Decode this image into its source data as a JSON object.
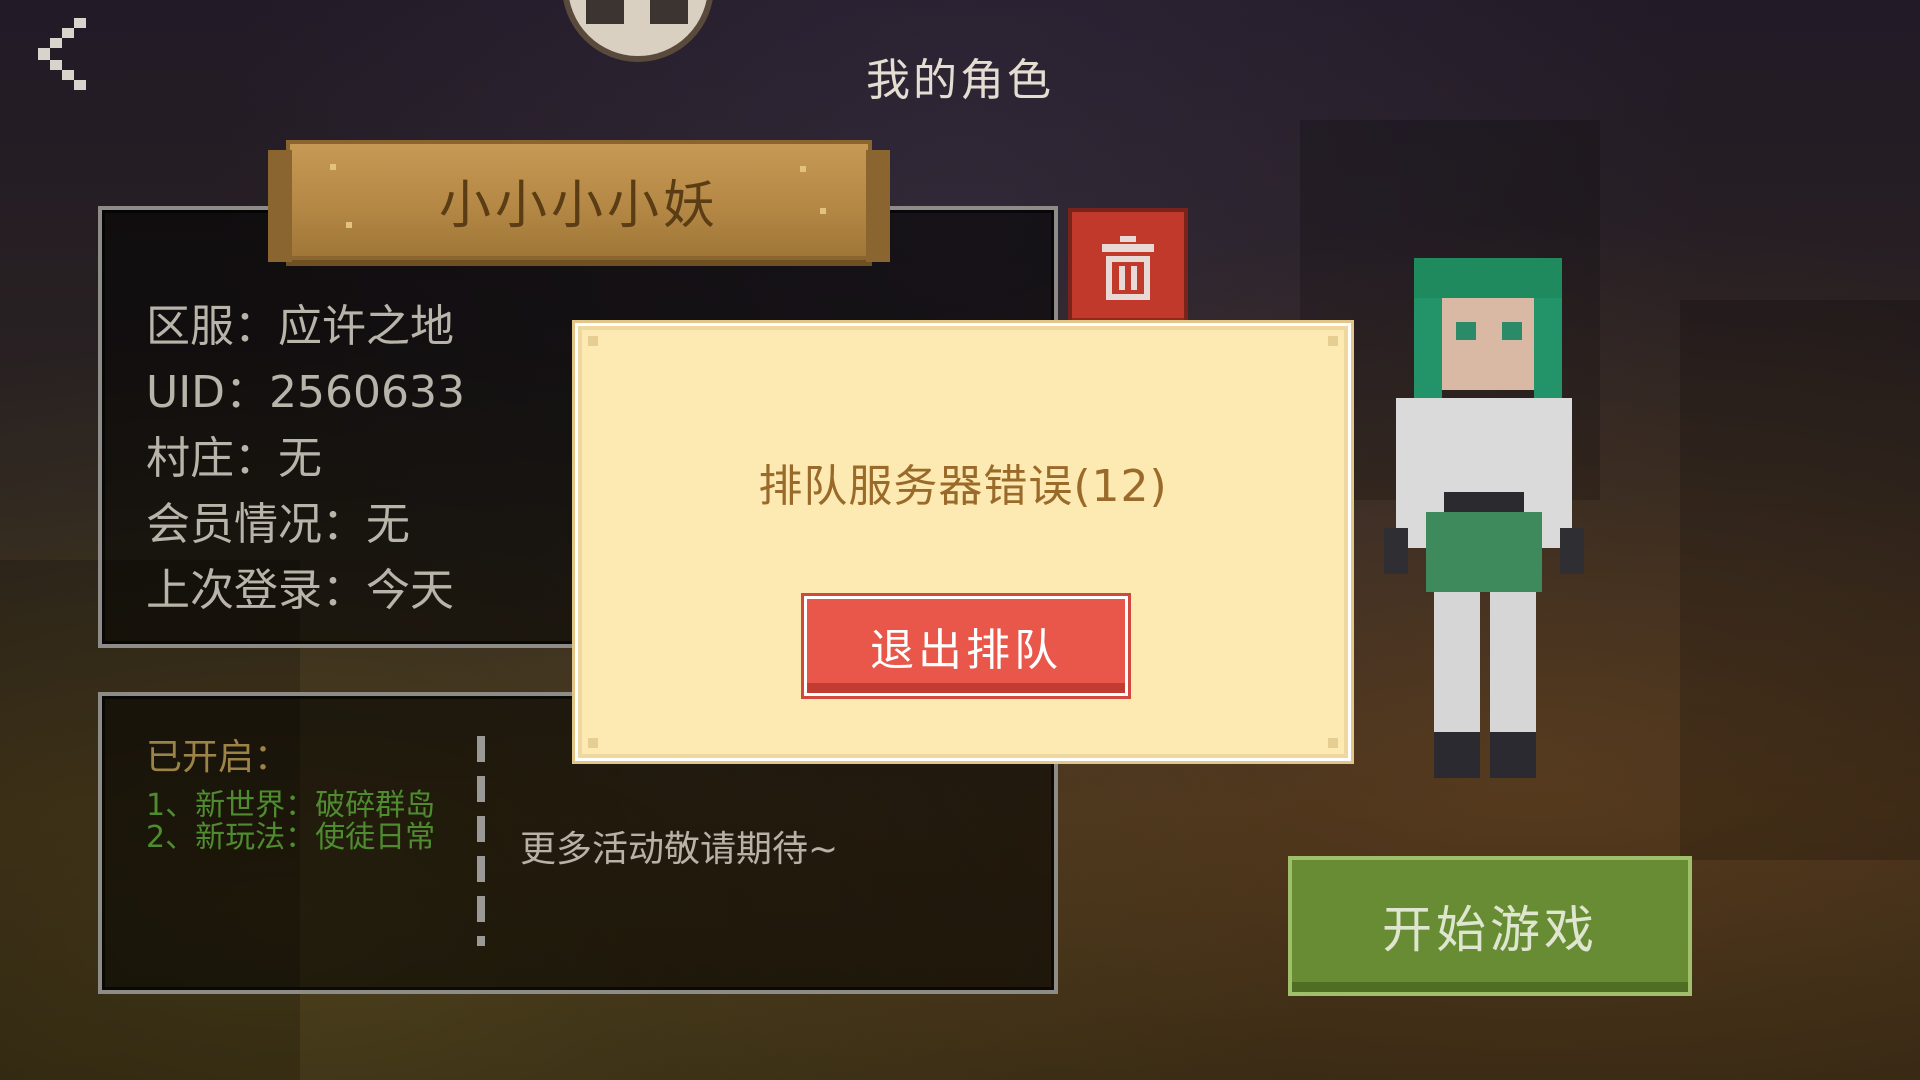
{
  "header": {
    "title": "我的角色",
    "back_icon": "chevron-left-icon"
  },
  "character": {
    "name": "小小小小妖",
    "info": [
      {
        "label": "区服：应许之地"
      },
      {
        "label": "UID：2560633"
      },
      {
        "label": "村庄：无"
      },
      {
        "label": "会员情况：无"
      },
      {
        "label": "上次登录：今天"
      }
    ],
    "delete_icon": "trash-icon"
  },
  "events": {
    "opened_title": "已开启：",
    "items": [
      "1、新世界：破碎群岛",
      "2、新玩法：使徒日常"
    ],
    "more_text": "更多活动敬请期待~"
  },
  "start_button": {
    "label": "开始游戏"
  },
  "modal": {
    "message": "排队服务器错误(12)",
    "button_label": "退出排队"
  },
  "colors": {
    "modal_bg": "#fdeab2",
    "modal_button": "#e9564a",
    "start_button": "#688c33",
    "name_plank": "#b58845",
    "trash_button": "#c0392b"
  }
}
